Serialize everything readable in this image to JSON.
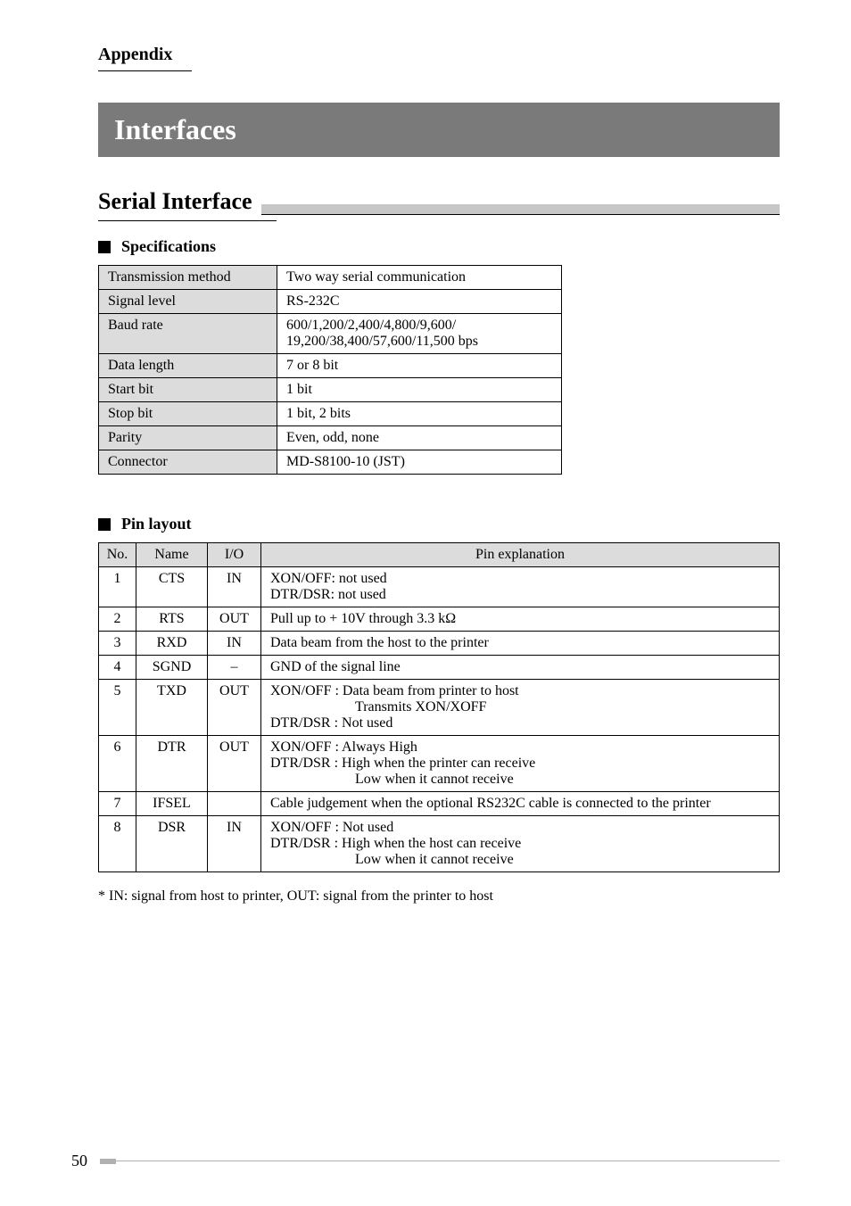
{
  "section_label": "Appendix",
  "title": "Interfaces",
  "subsection": "Serial Interface",
  "spec_heading": "Specifications",
  "spec_rows": [
    {
      "label": "Transmission method",
      "value": "Two way serial communication"
    },
    {
      "label": "Signal level",
      "value": "RS-232C"
    },
    {
      "label": "Baud rate",
      "value": "600/1,200/2,400/4,800/9,600/\n19,200/38,400/57,600/11,500 bps"
    },
    {
      "label": "Data length",
      "value": "7 or 8 bit"
    },
    {
      "label": "Start bit",
      "value": "1 bit"
    },
    {
      "label": "Stop bit",
      "value": "1 bit, 2 bits"
    },
    {
      "label": "Parity",
      "value": "Even, odd, none"
    },
    {
      "label": "Connector",
      "value": "MD-S8100-10 (JST)"
    }
  ],
  "pin_heading": "Pin layout",
  "pin_headers": {
    "no": "No.",
    "name": "Name",
    "io": "I/O",
    "expl": "Pin explanation"
  },
  "pin_rows": [
    {
      "no": "1",
      "name": "CTS",
      "io": "IN",
      "lines": [
        "XON/OFF:   not used",
        "DTR/DSR:   not used"
      ]
    },
    {
      "no": "2",
      "name": "RTS",
      "io": "OUT",
      "lines": [
        "Pull up to + 10V through 3.3 kΩ"
      ]
    },
    {
      "no": "3",
      "name": "RXD",
      "io": "IN",
      "lines": [
        "Data beam from the host to the printer"
      ]
    },
    {
      "no": "4",
      "name": "SGND",
      "io": "–",
      "lines": [
        "GND of the signal line"
      ]
    },
    {
      "no": "5",
      "name": "TXD",
      "io": "OUT",
      "lines": [
        "XON/OFF :  Data beam from printer to host"
      ],
      "indented": [
        "Transmits XON/XOFF"
      ],
      "lines2": [
        "DTR/DSR :  Not used"
      ]
    },
    {
      "no": "6",
      "name": "DTR",
      "io": "OUT",
      "lines": [
        "XON/OFF :  Always High",
        "DTR/DSR :  High when the printer can receive"
      ],
      "indented": [
        "Low when it cannot receive"
      ]
    },
    {
      "no": "7",
      "name": "IFSEL",
      "io": "",
      "lines": [
        "Cable judgement when the optional RS232C cable is connected to the printer"
      ]
    },
    {
      "no": "8",
      "name": "DSR",
      "io": "IN",
      "lines": [
        "XON/OFF :  Not used",
        "DTR/DSR :  High when the host can receive"
      ],
      "indented": [
        "Low when it cannot receive"
      ]
    }
  ],
  "footnote": "* IN: signal from host to printer, OUT: signal from the printer to host",
  "page_number": "50"
}
